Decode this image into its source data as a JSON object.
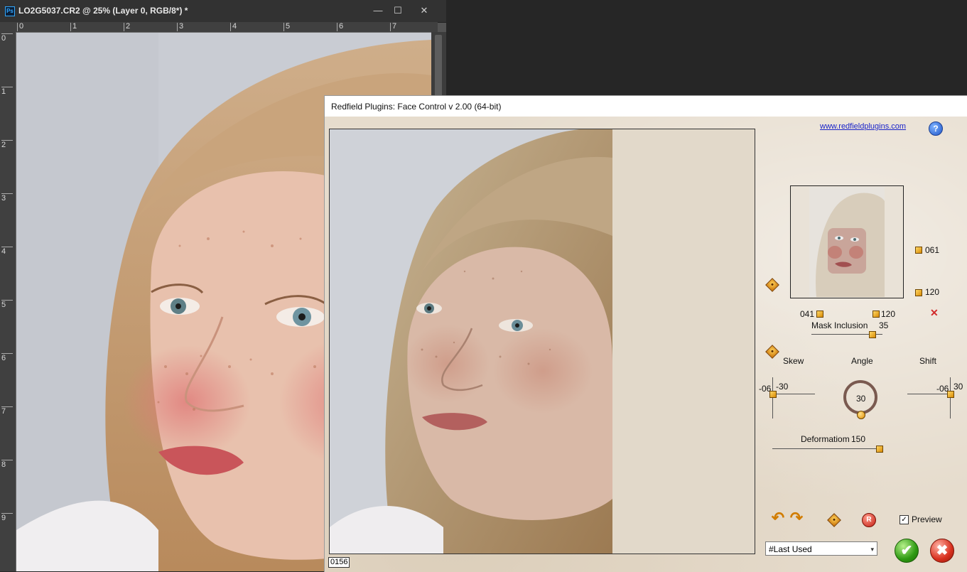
{
  "photoshop": {
    "app_icon": "Ps",
    "doc_title": "LO2G5037.CR2 @ 25% (Layer 0, RGB/8*) *",
    "window_buttons": {
      "minimize": "—",
      "maximize": "☐",
      "close": "✕"
    },
    "ruler_top": [
      "0",
      "1",
      "2",
      "3",
      "4",
      "5",
      "6",
      "7"
    ],
    "ruler_left": [
      "0",
      "1",
      "2",
      "3",
      "4",
      "5",
      "6",
      "7",
      "8",
      "9"
    ]
  },
  "dialog": {
    "title": "Redfield Plugins: Face Control v 2.00 (64-bit)",
    "site_link": "www.redfieldplugins.com",
    "help_icon": "?",
    "counter": "0156",
    "thumb_values": {
      "right_top": "061",
      "right_bottom": "120",
      "bottom_left": "041",
      "bottom_right": "120"
    },
    "mask_inclusion": {
      "label": "Mask Inclusion",
      "value": "35"
    },
    "skew": {
      "label": "Skew",
      "left_value": "-06",
      "right_value": "-30"
    },
    "angle": {
      "label": "Angle",
      "value": "30"
    },
    "shift": {
      "label": "Shift",
      "left_value": "-06",
      "right_value": "30"
    },
    "deformation": {
      "label": "Deformatiom",
      "value": "150"
    },
    "preview": {
      "label": "Preview",
      "checked": true,
      "check_mark": "✓"
    },
    "preset": {
      "selected": "#Last Used",
      "arrow": "▾"
    },
    "reset_label": "R",
    "undo_icon": "↶",
    "redo_icon": "↷",
    "ok_icon": "✔",
    "cancel_icon": "✖",
    "close_x": "✕",
    "colors": {
      "accent_orange": "#e08c00",
      "ok_green": "#2e9a12",
      "cancel_red": "#d8301e",
      "link_blue": "#1a23c9"
    }
  }
}
